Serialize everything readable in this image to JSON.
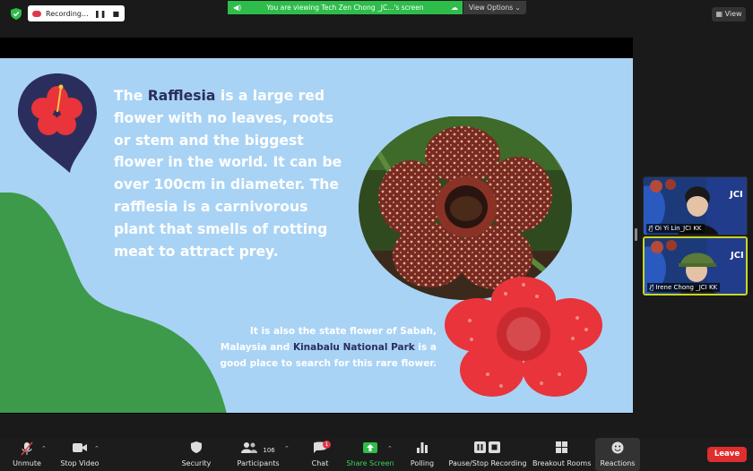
{
  "topbar": {
    "recording_label": "Recording...",
    "viewing_banner": "You are viewing Tech Zen Chong _JC...'s screen",
    "view_options_label": "View Options ⌄",
    "view_button_label": "View"
  },
  "slide": {
    "text_intro_1": "The ",
    "text_highlight_1": "Rafflesia",
    "text_body_1": " is a large red flower with no leaves, roots or stem and the biggest flower in the world. It can be over 100cm in diameter. The rafflesia is a carnivorous plant that smells of rotting meat to attract prey.",
    "text_sub_1": "It is also the state flower of Sabah, Malaysia and ",
    "text_highlight_2": "Kinabalu National Park",
    "text_sub_2": " is a good place to search for this rare flower.",
    "colors": {
      "background": "#a9d3f5",
      "green_blob": "#3c9a4a",
      "pin": "#2b2e5c",
      "hibiscus": "#e8343a",
      "text_highlight": "#2b2e5c"
    }
  },
  "participants": [
    {
      "name": "Oi Yi Lin_JCI KK",
      "active": false
    },
    {
      "name": "Irene Chong _JCI KK",
      "active": true
    }
  ],
  "toolbar": {
    "unmute": "Unmute",
    "stop_video": "Stop Video",
    "security": "Security",
    "participants": "Participants",
    "participants_count": "106",
    "chat": "Chat",
    "chat_badge": "1",
    "share_screen": "Share Screen",
    "polling": "Polling",
    "pause_recording": "Pause/Stop Recording",
    "breakout_rooms": "Breakout Rooms",
    "reactions": "Reactions",
    "leave": "Leave"
  },
  "icons": {
    "shield": "shield-icon",
    "mic_muted": "mic-muted-icon",
    "camera": "camera-icon",
    "security": "security-shield-icon",
    "participants": "people-icon",
    "chat": "chat-bubble-icon",
    "share": "share-arrow-icon",
    "polling": "bar-chart-icon",
    "pause": "pause-icon",
    "breakout": "grid-icon",
    "reactions": "smiley-icon"
  }
}
